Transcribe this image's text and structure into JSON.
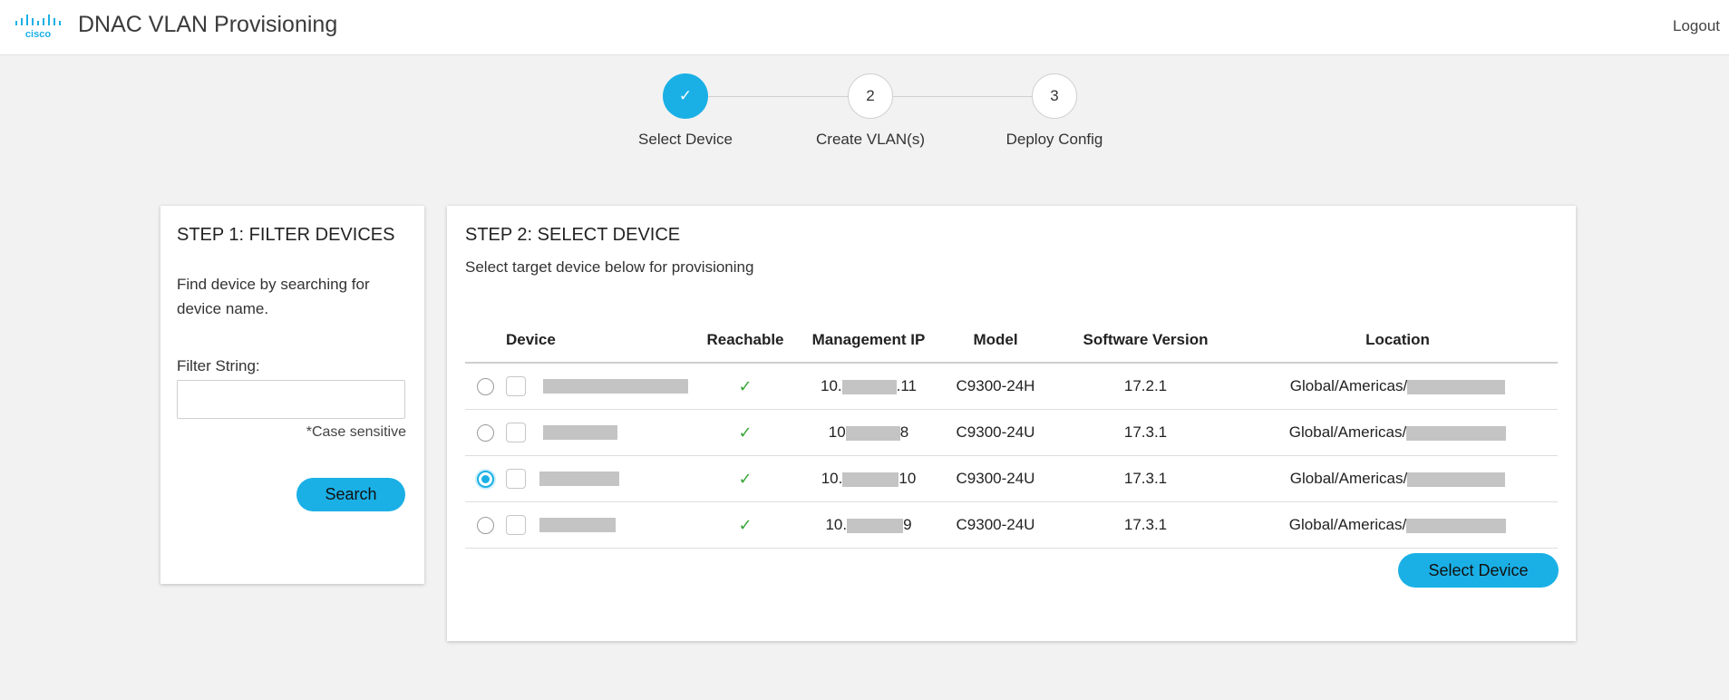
{
  "header": {
    "brand": "cisco",
    "title": "DNAC VLAN Provisioning",
    "logout_label": "Logout",
    "accent_color": "#1ab0e6"
  },
  "stepper": {
    "steps": [
      {
        "label": "Select Device",
        "marker": "✓",
        "state": "active"
      },
      {
        "label": "Create VLAN(s)",
        "marker": "2",
        "state": "todo"
      },
      {
        "label": "Deploy Config",
        "marker": "3",
        "state": "todo"
      }
    ]
  },
  "filter_card": {
    "title": "STEP 1: FILTER DEVICES",
    "description": "Find device by searching for device name.",
    "field_label": "Filter String:",
    "field_value": "",
    "hint": "*Case sensitive",
    "search_label": "Search"
  },
  "select_card": {
    "title": "STEP 2: SELECT DEVICE",
    "subtitle": "Select target device below for provisioning",
    "columns": [
      "Device",
      "Reachable",
      "Management IP",
      "Model",
      "Software Version",
      "Location"
    ],
    "rows": [
      {
        "selected": false,
        "reachable": "✓",
        "ip_prefix": "10.",
        "ip_suffix": ".11",
        "model": "C9300-24H",
        "version": "17.2.1",
        "location": "Global/Americas/"
      },
      {
        "selected": false,
        "reachable": "✓",
        "ip_prefix": "10",
        "ip_suffix": "8",
        "model": "C9300-24U",
        "version": "17.3.1",
        "location": "Global/Americas/"
      },
      {
        "selected": true,
        "reachable": "✓",
        "ip_prefix": "10.",
        "ip_suffix": "10",
        "model": "C9300-24U",
        "version": "17.3.1",
        "location": "Global/Americas/"
      },
      {
        "selected": false,
        "reachable": "✓",
        "ip_prefix": "10.",
        "ip_suffix": "9",
        "model": "C9300-24U",
        "version": "17.3.1",
        "location": "Global/Americas/"
      }
    ],
    "select_label": "Select Device"
  }
}
